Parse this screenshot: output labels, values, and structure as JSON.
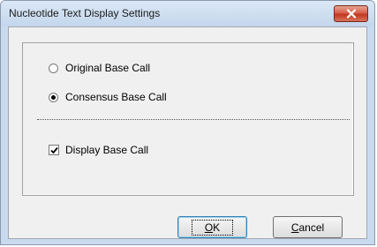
{
  "window": {
    "title": "Nucleotide Text Display Settings"
  },
  "options": {
    "original_label": "Original Base Call",
    "original_selected": false,
    "consensus_label": "Consensus Base Call",
    "consensus_selected": true
  },
  "display": {
    "label": "Display Base Call",
    "checked": true
  },
  "buttons": {
    "ok_label": "OK",
    "cancel_label": "Cancel"
  },
  "icons": {
    "close": "close-icon",
    "checkmark": "checkmark-icon"
  },
  "colors": {
    "close_button": "#c2371f",
    "titlebar": "#c3d6ec",
    "client": "#f0f0f0"
  }
}
